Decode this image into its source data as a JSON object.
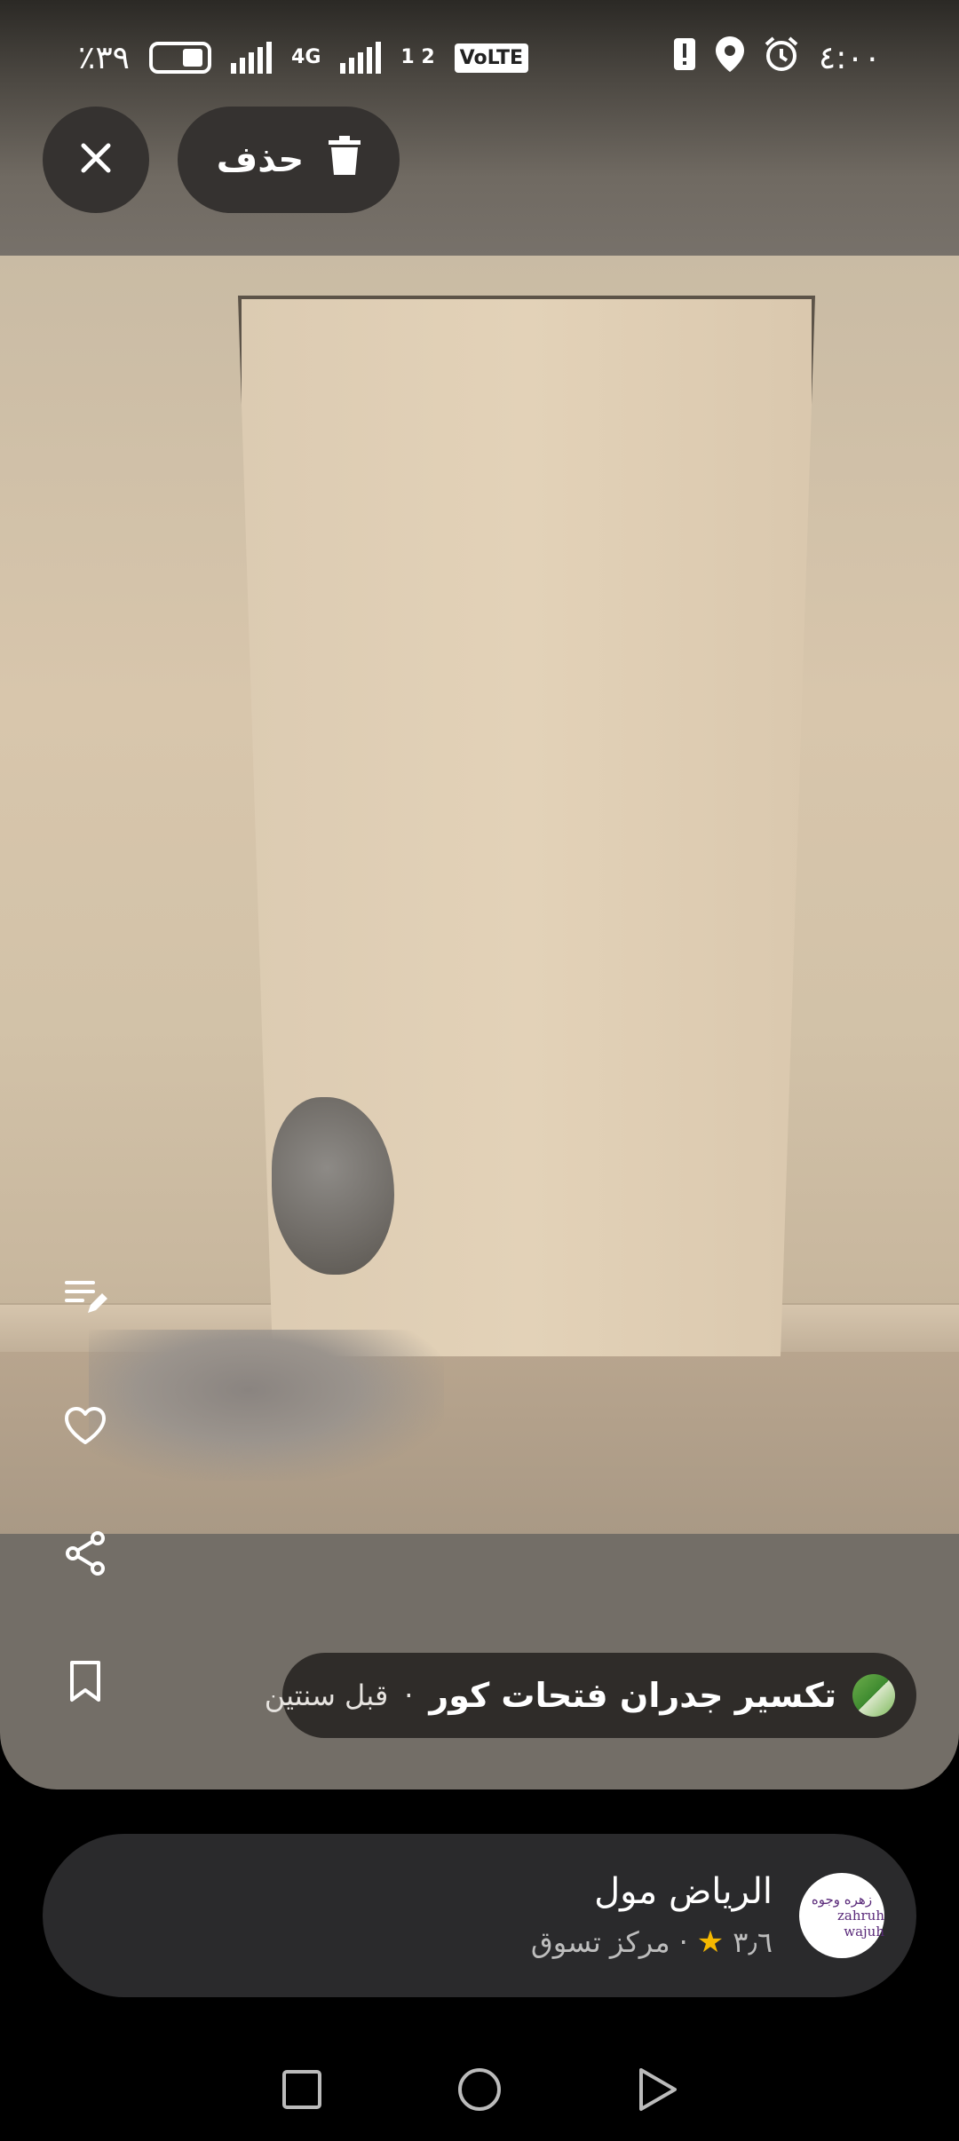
{
  "status_bar": {
    "battery_percent": "٪٣٩",
    "network": "4G",
    "sim_slots": "1 2",
    "volte": "VoLTE",
    "time": "٤:٠٠"
  },
  "toolbar": {
    "delete_label": "حذف"
  },
  "photo_caption": {
    "title": "تكسير جدران فتحات كور",
    "separator": "·",
    "time_ago": "قبل سنتين"
  },
  "place_card": {
    "name": "الرياض مول",
    "rating": "٣٫٦",
    "separator": "·",
    "category": "مركز تسوق",
    "logo_text_ar": "زهره وجوه",
    "logo_text_en": "zahruh wajuh"
  },
  "colors": {
    "rating_star": "#f5b800",
    "chip_background": "#2f2c29",
    "card_background": "#2a2a2c"
  }
}
